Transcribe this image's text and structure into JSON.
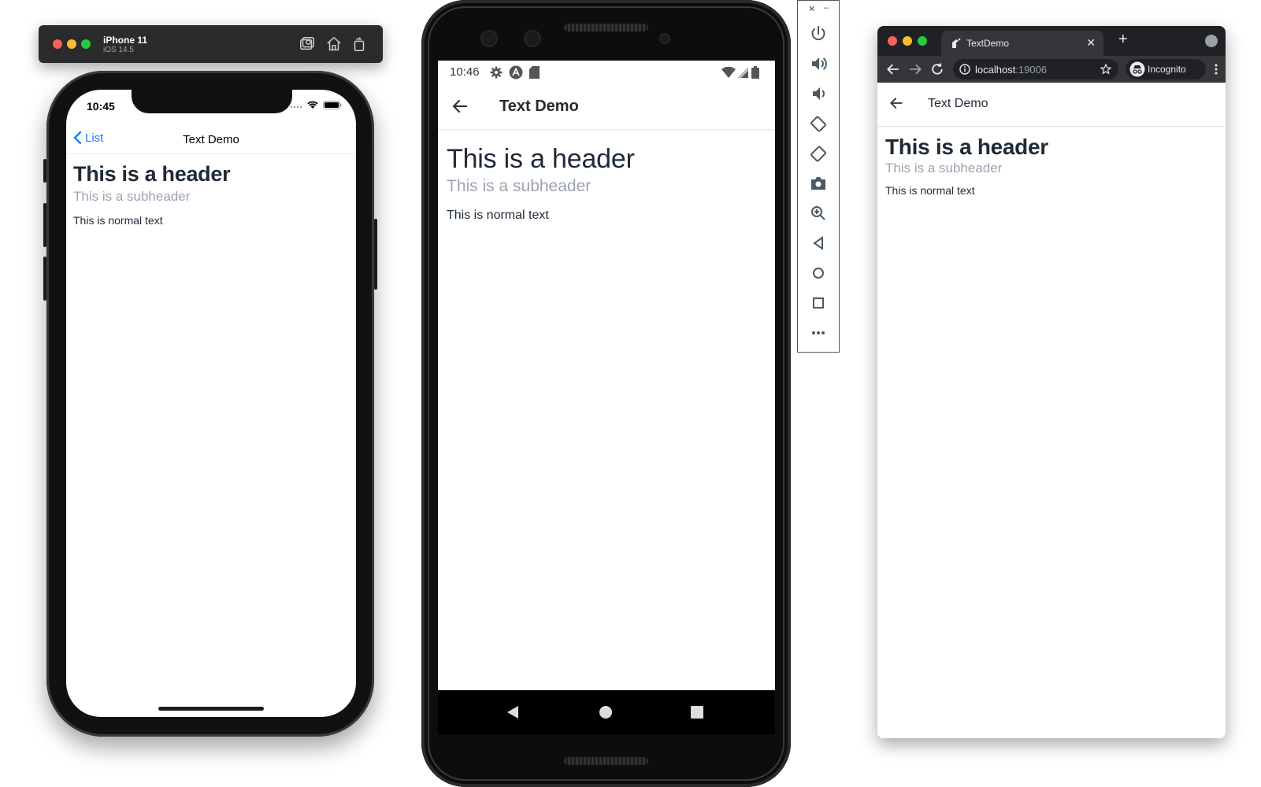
{
  "ios_simulator": {
    "device_name": "iPhone 11",
    "os_version": "iOS 14.5",
    "toolbar_icons": [
      "screenshot-icon",
      "home-icon",
      "rotate-icon"
    ],
    "status_time": "10:45",
    "nav": {
      "back_label": "List",
      "title": "Text Demo"
    },
    "content": {
      "header": "This is a header",
      "subheader": "This is a subheader",
      "text": "This is normal text"
    }
  },
  "android_emulator": {
    "status_time": "10:46",
    "status_icons": [
      "settings-icon",
      "a-circle-icon",
      "sd-card-icon",
      "wifi-icon",
      "signal-icon",
      "battery-icon"
    ],
    "appbar": {
      "title": "Text Demo"
    },
    "content": {
      "header": "This is a header",
      "subheader": "This is a subheader",
      "text": "This is normal text"
    },
    "navbar": [
      "back-triangle-icon",
      "home-circle-icon",
      "recents-square-icon"
    ]
  },
  "emulator_panel": {
    "window_controls": [
      "close-icon",
      "minimize-icon"
    ],
    "buttons": [
      "power-icon",
      "volume-up-icon",
      "volume-down-icon",
      "rotate-left-icon",
      "rotate-right-icon",
      "camera-icon",
      "zoom-icon",
      "back-icon",
      "home-icon",
      "overview-icon",
      "more-icon"
    ]
  },
  "chrome": {
    "tab_title": "TextDemo",
    "url_host": "localhost",
    "url_port": ":19006",
    "incognito_label": "Incognito",
    "page": {
      "title": "Text Demo",
      "header": "This is a header",
      "subheader": "This is a subheader",
      "text": "This is normal text"
    }
  },
  "colors": {
    "ios_link": "#147efb",
    "header_text": "#1f2937",
    "subheader_text": "#9ca3af",
    "chrome_dark": "#202124"
  }
}
